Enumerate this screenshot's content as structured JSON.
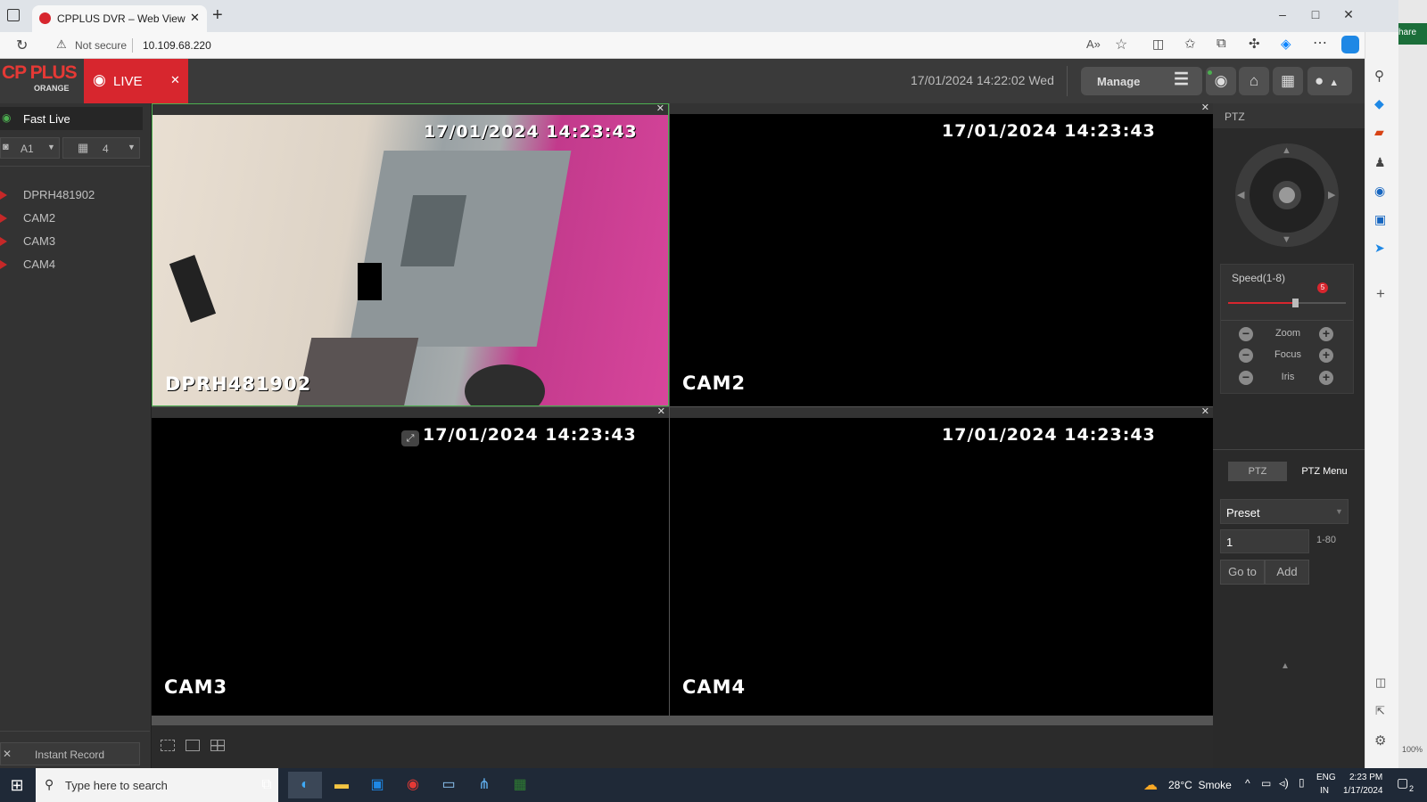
{
  "browser": {
    "tab_title": "CPPLUS DVR – Web View",
    "new_tab": "+",
    "security_label": "Not secure",
    "url": "10.109.68.220",
    "read_aloud": "A)",
    "window_controls": [
      "–",
      "□",
      "✕"
    ],
    "share_partial": "hare"
  },
  "app": {
    "logo_main": "CP PLUS",
    "logo_sub": "ORANGE",
    "live_tab": "LIVE",
    "datetime": "17/01/2024 14:22:02 Wed",
    "manage_label": "Manage",
    "fast_live": "Fast Live",
    "stream_select": "A1",
    "layout_select": "4",
    "cameras": [
      "DPRH481902",
      "CAM2",
      "CAM3",
      "CAM4"
    ],
    "instant_record": "Instant Record",
    "cells": [
      {
        "timestamp": "17/01/2024 14:23:43",
        "name": "DPRH481902"
      },
      {
        "timestamp": "17/01/2024 14:23:43",
        "name": "CAM2"
      },
      {
        "timestamp": "17/01/2024 14:23:43",
        "name": "CAM3"
      },
      {
        "timestamp": "17/01/2024 14:23:43",
        "name": "CAM4"
      }
    ],
    "ptz": {
      "title": "PTZ",
      "speed_label": "Speed(1-8)",
      "speed_value": "5",
      "speed_fraction": 0.57,
      "zoom_label": "Zoom",
      "focus_label": "Focus",
      "iris_label": "Iris",
      "tab_ptz": "PTZ",
      "tab_menu": "PTZ Menu",
      "preset_select": "Preset",
      "preset_number": "1",
      "preset_range": "1-80",
      "goto_label": "Go to",
      "add_label": "Add"
    }
  },
  "taskbar": {
    "search_placeholder": "Type here to search",
    "weather": "28°C  Smoke",
    "lang_top": "ENG",
    "lang_bottom": "IN",
    "time": "2:23 PM",
    "date": "1/17/2024",
    "notification_count": "2",
    "zoom_pct": "100%"
  },
  "colors": {
    "live_red": "#d7262e",
    "active_cell_border": "#4caf50",
    "panel_dark": "#2d2d2d"
  }
}
